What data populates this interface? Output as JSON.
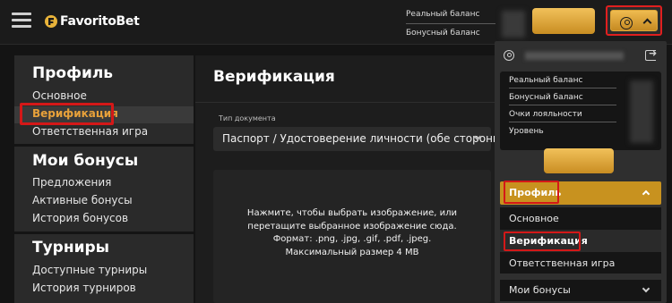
{
  "header": {
    "logo_text": "FavoritoBet",
    "real_balance_label": "Реальный баланс",
    "bonus_balance_label": "Бонусный баланс"
  },
  "sidebar": {
    "sections": [
      {
        "title": "Профиль",
        "items": [
          "Основное",
          "Верификация",
          "Ответственная игра"
        ]
      },
      {
        "title": "Мои бонусы",
        "items": [
          "Предложения",
          "Активные бонусы",
          "История бонусов"
        ]
      },
      {
        "title": "Турниры",
        "items": [
          "Доступные турниры",
          "История турниров"
        ]
      }
    ],
    "active_item": "Верификация"
  },
  "main": {
    "title": "Верификация",
    "doc_type_label": "Тип документа",
    "doc_type_value": "Паспорт / Удостоверение личности (обе стороны)",
    "upload_line1": "Нажмите, чтобы выбрать изображение, или",
    "upload_line2": "перетащите выбранное изображение сюда.",
    "upload_line3": "Формат: .png, .jpg, .gif, .pdf, .jpeg.",
    "upload_line4": "Максимальный размер 4 MB"
  },
  "dropdown": {
    "balance_items": [
      "Реальный баланс",
      "Бонусный баланс",
      "Очки лояльности",
      "Уровень"
    ],
    "profile_header": "Профиль",
    "profile_items": [
      "Основное",
      "Верификация",
      "Ответственная игра"
    ],
    "bonus_header": "Мои бонусы"
  },
  "colors": {
    "accent": "#e8a13a",
    "gold": "#c8921f",
    "highlight": "#d41818",
    "background": "#141414"
  }
}
